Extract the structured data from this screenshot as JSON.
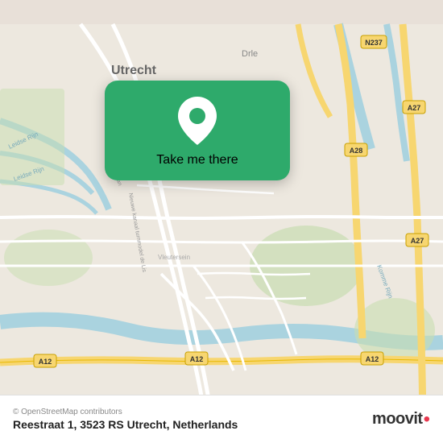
{
  "map": {
    "background_color": "#ede8df"
  },
  "popup": {
    "label": "Take me there",
    "pin_color": "#ffffff"
  },
  "bottom_bar": {
    "copyright": "© OpenStreetMap contributors",
    "address": "Reestraat 1, 3523 RS Utrecht, Netherlands",
    "logo": "moovit"
  }
}
